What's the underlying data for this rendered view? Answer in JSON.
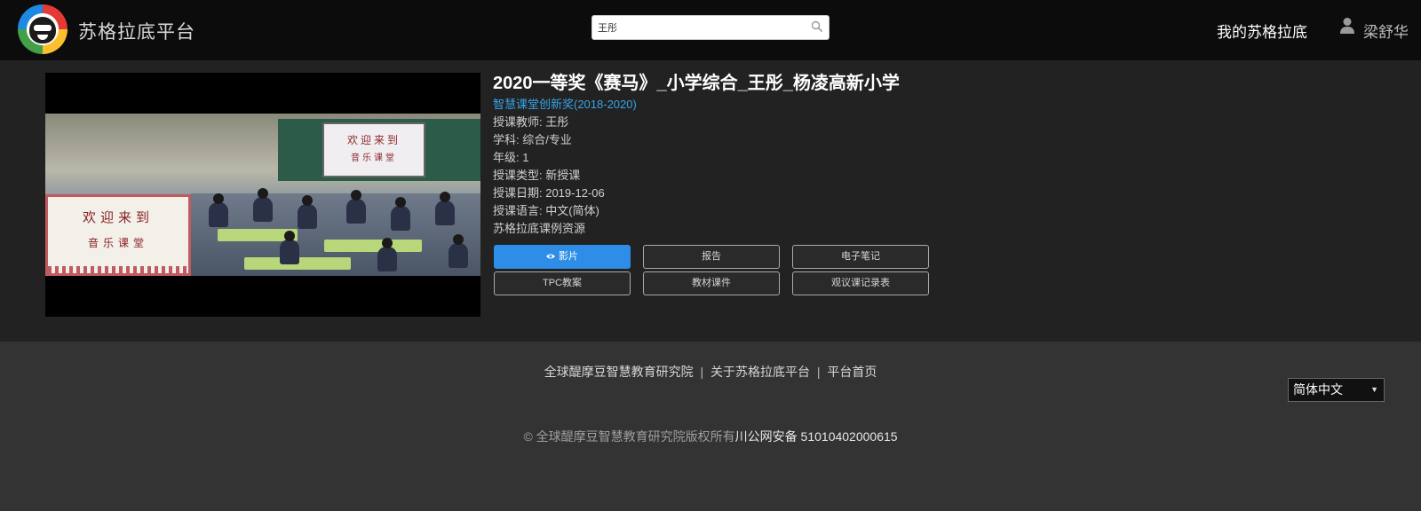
{
  "header": {
    "site_title": "苏格拉底平台",
    "search_value": "王彤",
    "nav_my": "我的苏格拉底",
    "user_name": "梁舒华"
  },
  "video": {
    "screen_line1": "欢迎来到",
    "screen_line2": "音乐课堂",
    "pip_line1": "欢迎来到",
    "pip_line2": "音乐课堂"
  },
  "lesson": {
    "title": "2020一等奖《赛马》_小学综合_王彤_杨凌高新小学",
    "award": "智慧课堂创新奖(2018-2020)",
    "teacher": "授课教师: 王彤",
    "subject": "学科: 综合/专业",
    "grade": "年级: 1",
    "type": "授课类型: 新授课",
    "date": "授课日期: 2019-12-06",
    "language": "授课语言: 中文(简体)",
    "source": "苏格拉底课例资源"
  },
  "buttons": {
    "video": "影片",
    "report": "报告",
    "notes": "电子笔记",
    "tpc": "TPC教案",
    "materials": "教材课件",
    "observation": "观议课记录表"
  },
  "footer": {
    "link1": "全球醍摩豆智慧教育研究院",
    "link2": "关于苏格拉底平台",
    "link3": "平台首页",
    "sep": "|",
    "language": "简体中文",
    "copyright": "© 全球醍摩豆智慧教育研究院版权所有",
    "icp": "川公网安备 51010402000615"
  },
  "colors": {
    "accent": "#2e8de6",
    "award": "#35a4e8",
    "header_bg": "#0c0c0c",
    "main_bg": "#222222",
    "footer_bg": "#333333"
  },
  "icons": [
    "logo",
    "search-icon",
    "user-icon",
    "eye-icon",
    "chevron-down-icon"
  ]
}
